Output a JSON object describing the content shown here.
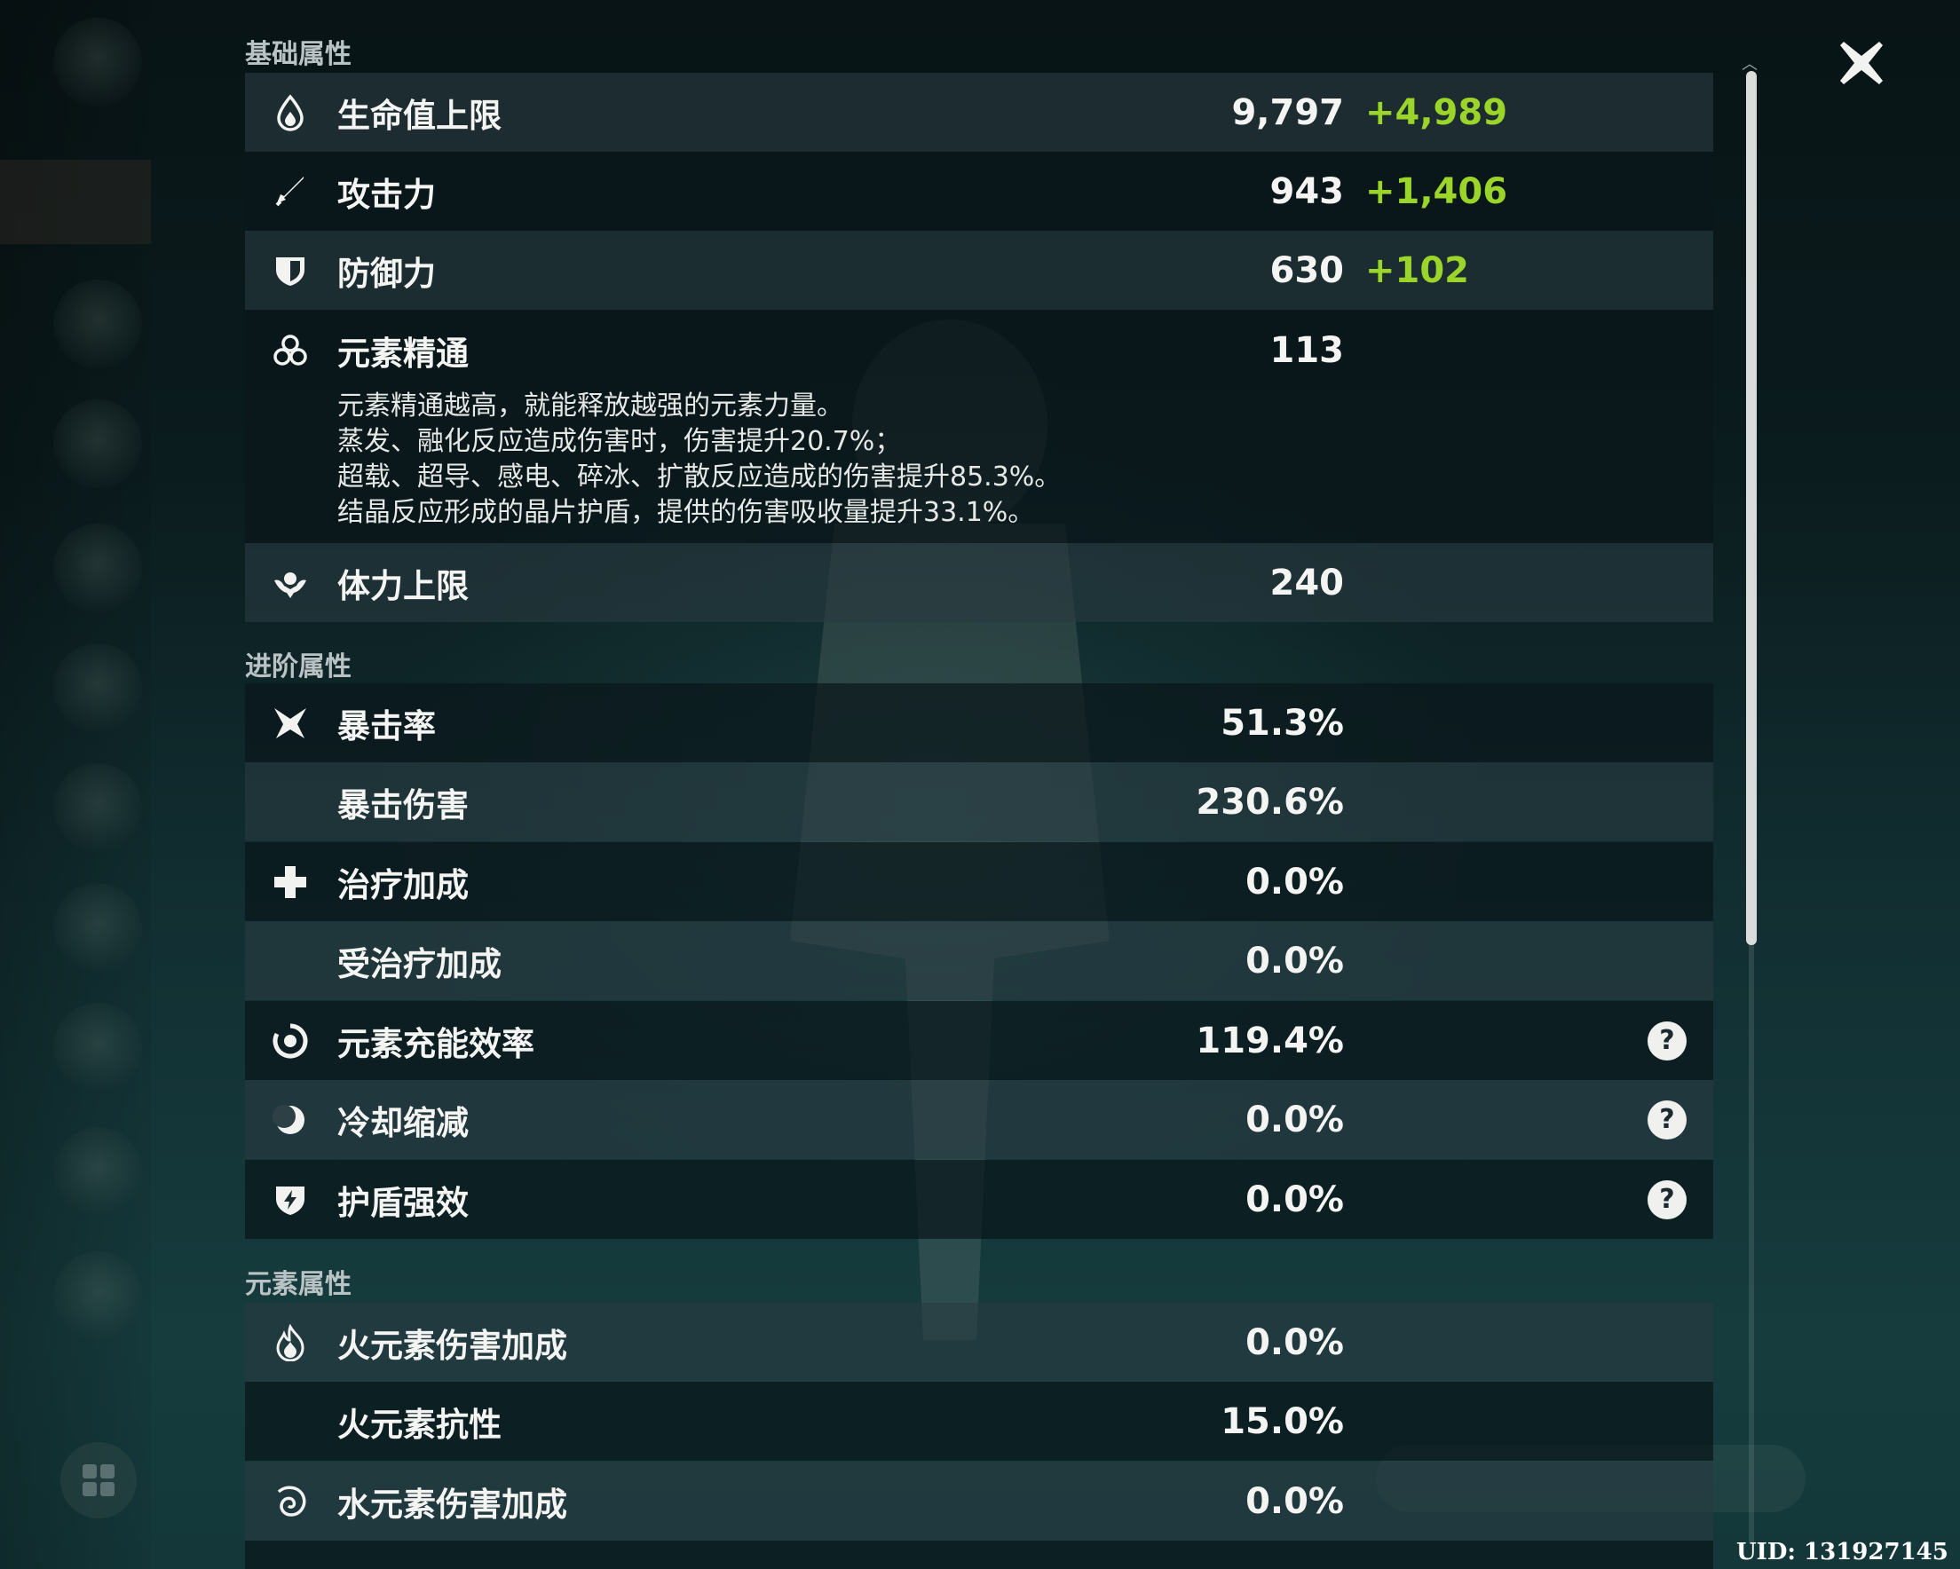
{
  "sections": {
    "basic": "基础属性",
    "advanced": "进阶属性",
    "elemental": "元素属性"
  },
  "basic_stats": [
    {
      "label": "生命值上限",
      "value": "9,797",
      "bonus": "+4,989",
      "icon": "hp-droplet-icon"
    },
    {
      "label": "攻击力",
      "value": "943",
      "bonus": "+1,406",
      "icon": "sword-icon"
    },
    {
      "label": "防御力",
      "value": "630",
      "bonus": "+102",
      "icon": "shield-icon"
    },
    {
      "label": "元素精通",
      "value": "113",
      "icon": "elemental-mastery-icon"
    },
    {
      "label": "体力上限",
      "value": "240",
      "icon": "stamina-icon"
    }
  ],
  "elemental_mastery_desc": [
    "元素精通越高，就能释放越强的元素力量。",
    "蒸发、融化反应造成伤害时，伤害提升20.7%；",
    "超载、超导、感电、碎冰、扩散反应造成的伤害提升85.3%。",
    "结晶反应形成的晶片护盾，提供的伤害吸收量提升33.1%。"
  ],
  "advanced_stats": [
    {
      "label": "暴击率",
      "value": "51.3%",
      "icon": "crit-rate-icon"
    },
    {
      "label": "暴击伤害",
      "value": "230.6%"
    },
    {
      "label": "治疗加成",
      "value": "0.0%",
      "icon": "healing-cross-icon"
    },
    {
      "label": "受治疗加成",
      "value": "0.0%"
    },
    {
      "label": "元素充能效率",
      "value": "119.4%",
      "icon": "energy-recharge-icon",
      "help": "?"
    },
    {
      "label": "冷却缩减",
      "value": "0.0%",
      "icon": "cooldown-icon",
      "help": "?"
    },
    {
      "label": "护盾强效",
      "value": "0.0%",
      "icon": "shield-strength-icon",
      "help": "?"
    }
  ],
  "elemental_stats": [
    {
      "label": "火元素伤害加成",
      "value": "0.0%",
      "icon": "pyro-icon"
    },
    {
      "label": "火元素抗性",
      "value": "15.0%"
    },
    {
      "label": "水元素伤害加成",
      "value": "0.0%",
      "icon": "hydro-icon"
    }
  ],
  "uid": "UID: 131927145",
  "colors": {
    "bonus_green": "#9bd52a",
    "row_dark": "#0a161a",
    "row_light": "#283a40"
  }
}
